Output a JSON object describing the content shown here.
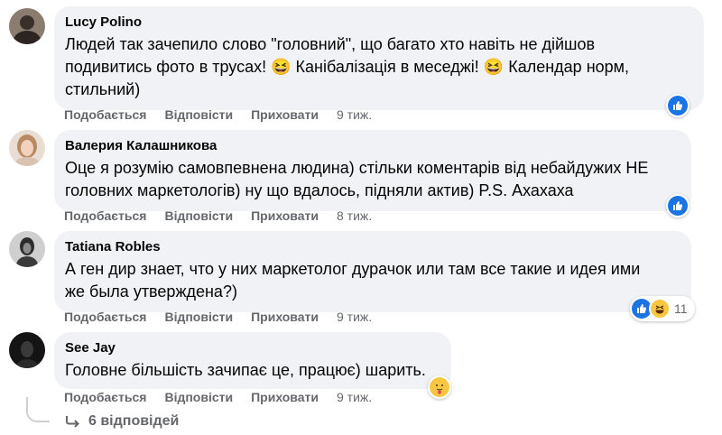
{
  "comments": [
    {
      "author": "Lucy Polino",
      "text_lines": [
        "Людей так зачепило слово \"головний\", що багато хто навіть не дійшов",
        "подивитись фото в трусах! 😆 Канібалізація в меседжі! 😆 Календар норм,",
        "стильний)"
      ],
      "like_label": "Подобається",
      "reply_label": "Відповісти",
      "hide_label": "Приховати",
      "time": "9 тиж.",
      "reactions": [
        "like-icon"
      ],
      "reaction_count": ""
    },
    {
      "author": "Валерия Калашникова",
      "text_lines": [
        "Оце я розумію самовпевнена людина) стільки коментарів від небайдужих НЕ",
        "головних маркетологів) ну що вдалось, підняли актив) P.S. Ахахаха"
      ],
      "like_label": "Подобається",
      "reply_label": "Відповісти",
      "hide_label": "Приховати",
      "time": "8 тиж.",
      "reactions": [
        "like-icon"
      ],
      "reaction_count": ""
    },
    {
      "author": "Tatiana Robles",
      "text_lines": [
        "А ген дир знает, что у них маркетолог дурачок или там все такие и идея ими",
        "же была утверждена?)"
      ],
      "like_label": "Подобається",
      "reply_label": "Відповісти",
      "hide_label": "Приховати",
      "time": "9 тиж.",
      "reactions": [
        "like-icon",
        "haha-icon"
      ],
      "reaction_count": "11"
    },
    {
      "author": "See Jay",
      "text_lines": [
        "Головне більшість зачипає це, працює) шарить."
      ],
      "like_label": "Подобається",
      "reply_label": "Відповісти",
      "hide_label": "Приховати",
      "time": "9 тиж.",
      "reactions": [
        "care-icon"
      ],
      "reaction_count": ""
    }
  ],
  "replies_link": "6 відповідей",
  "colors": {
    "bubble": "#f0f2f5",
    "meta_text": "#65676b",
    "like_blue": "#1b74e4",
    "emoji_yellow": "#f7c742"
  }
}
